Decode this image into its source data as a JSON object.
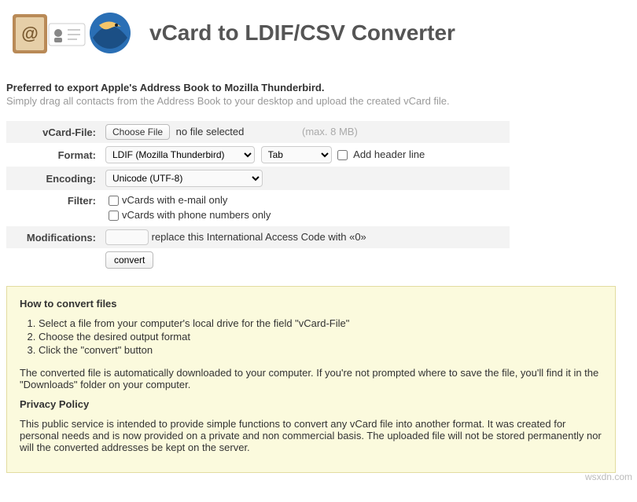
{
  "header": {
    "title": "vCard to LDIF/CSV Converter"
  },
  "intro": {
    "strong": "Preferred to export Apple's Address Book to Mozilla Thunderbird.",
    "sub": "Simply drag all contacts from the Address Book to your desktop and upload the created vCard file."
  },
  "form": {
    "vcard_label": "vCard-File:",
    "choose_file": "Choose File",
    "no_file": "no file selected",
    "max_hint": "(max. 8 MB)",
    "format_label": "Format:",
    "format_selected": "LDIF (Mozilla Thunderbird)",
    "tab_selected": "Tab",
    "add_header": "Add header line",
    "encoding_label": "Encoding:",
    "encoding_selected": "Unicode (UTF-8)",
    "filter_label": "Filter:",
    "filter_email": "vCards with e-mail only",
    "filter_phone": "vCards with phone numbers only",
    "mods_label": "Modifications:",
    "mods_text": "replace this International Access Code with «0»",
    "convert": "convert"
  },
  "info": {
    "how_title": "How to convert files",
    "step1": "Select a file from your computer's local drive for the field \"vCard-File\"",
    "step2": "Choose the desired output format",
    "step3": "Click the \"convert\" button",
    "auto_dl": "The converted file is automatically downloaded to your computer. If you're not prompted where to save the file, you'll find it in the \"Downloads\" folder on your computer.",
    "privacy_title": "Privacy Policy",
    "privacy_text": "This public service is intended to provide simple functions to convert any vCard file into another format. It was created for personal needs and is now provided on a private and non commercial basis. The uploaded file will not be stored permanently nor will the converted addresses be kept on the server."
  },
  "watermark": "wsxdn.com"
}
